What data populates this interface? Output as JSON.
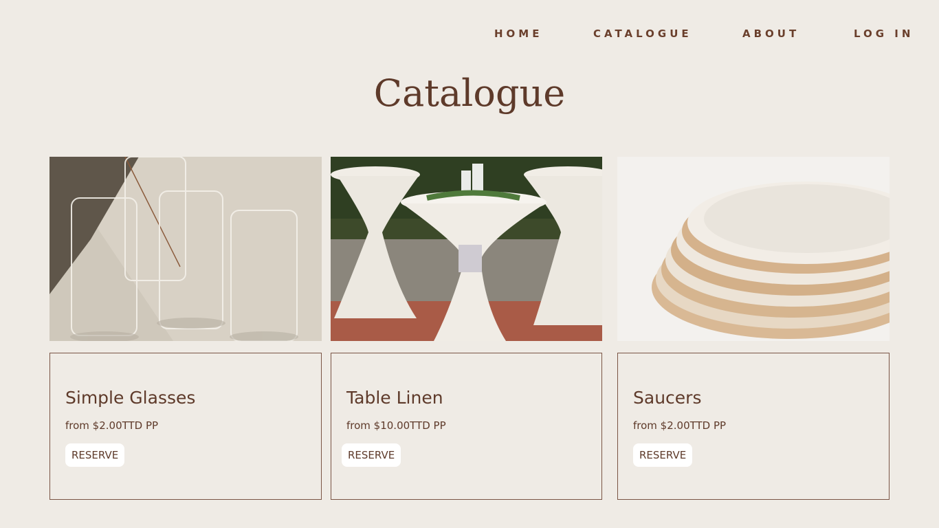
{
  "nav": {
    "home": "HOME",
    "catalogue": "CATALOGUE",
    "about": "ABOUT",
    "login": "LOG IN"
  },
  "page": {
    "title": "Catalogue"
  },
  "products": [
    {
      "name": "Simple Glasses",
      "price": "from $2.00TTD PP",
      "button": "RESERVE",
      "image_icon": "glasses-photo"
    },
    {
      "name": "Table Linen",
      "price": "from $10.00TTD PP",
      "button": "RESERVE",
      "image_icon": "table-linen-photo"
    },
    {
      "name": "Saucers",
      "price": "from $2.00TTD PP",
      "button": "RESERVE",
      "image_icon": "saucers-photo"
    }
  ],
  "colors": {
    "background": "#efebe5",
    "brand_brown": "#5e3a2a",
    "button_bg": "#ffffff",
    "card_border": "#7a5444"
  }
}
